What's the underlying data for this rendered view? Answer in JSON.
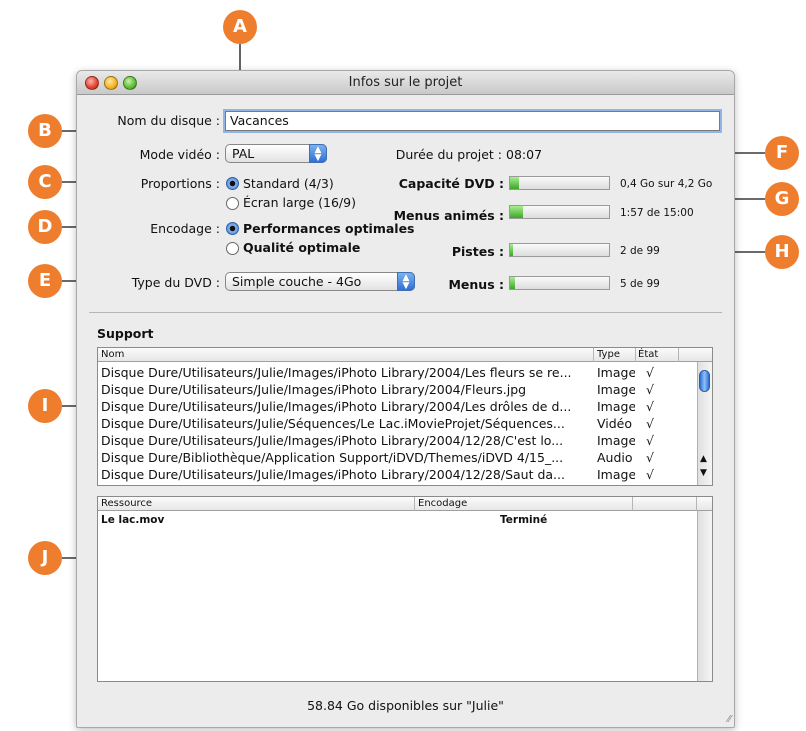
{
  "window": {
    "title": "Infos sur le projet"
  },
  "disc_name": {
    "label": "Nom du disque :",
    "value": "Vacances"
  },
  "video_mode": {
    "label": "Mode vidéo :",
    "value": "PAL"
  },
  "duration": {
    "label": "Durée du projet :",
    "value": "08:07"
  },
  "proportions": {
    "label": "Proportions :",
    "options": [
      "Standard (4/3)",
      "Écran large (16/9)"
    ],
    "selected": 0
  },
  "encoding": {
    "label": "Encodage :",
    "options": [
      "Performances optimales",
      "Qualité optimale"
    ],
    "selected": 0
  },
  "dvd_type": {
    "label": "Type du DVD :",
    "value": "Simple couche - 4Go"
  },
  "gauges": [
    {
      "label": "Capacité DVD :",
      "text": "0,4 Go sur 4,2 Go",
      "fraction": 0.09
    },
    {
      "label": "Menus animés :",
      "text": "1:57 de 15:00",
      "fraction": 0.13
    },
    {
      "label": "Pistes :",
      "text": "2 de 99",
      "fraction": 0.02
    },
    {
      "label": "Menus :",
      "text": "5 de 99",
      "fraction": 0.05
    }
  ],
  "support": {
    "title": "Support",
    "columns": [
      "Nom",
      "Type",
      "État"
    ],
    "rows": [
      [
        "Disque Dure/Utilisateurs/Julie/Images/iPhoto Library/2004/Les fleurs se re...",
        "Image",
        "√"
      ],
      [
        "Disque Dure/Utilisateurs/Julie/Images/iPhoto Library/2004/Fleurs.jpg",
        "Image",
        "√"
      ],
      [
        "Disque Dure/Utilisateurs/Julie/Images/iPhoto Library/2004/Les drôles de d...",
        "Image",
        "√"
      ],
      [
        "Disque Dure/Utilisateurs/Julie/Séquences/Le Lac.iMovieProjet/Séquences...",
        "Vidéo",
        "√"
      ],
      [
        "Disque Dure/Utilisateurs/Julie/Images/iPhoto Library/2004/12/28/C'est lo...",
        "Image",
        "√"
      ],
      [
        "Disque Dure/Bibliothèque/Application Support/iDVD/Themes/iDVD 4/15_...",
        "Audio",
        "√"
      ],
      [
        "Disque Dure/Utilisateurs/Julie/Images/iPhoto Library/2004/12/28/Saut da...",
        "Image",
        "√"
      ]
    ]
  },
  "resources": {
    "columns": [
      "Ressource",
      "Encodage"
    ],
    "rows": [
      [
        "Le lac.mov",
        "Terminé"
      ]
    ]
  },
  "footer": "58.84 Go disponibles sur \"Julie\"",
  "callouts": [
    "A",
    "B",
    "C",
    "D",
    "E",
    "F",
    "G",
    "H",
    "I",
    "J"
  ],
  "colors": {
    "callout": "#ef7d2e",
    "gauge": "#4fb63a",
    "select_blue": "#3a79d6"
  }
}
